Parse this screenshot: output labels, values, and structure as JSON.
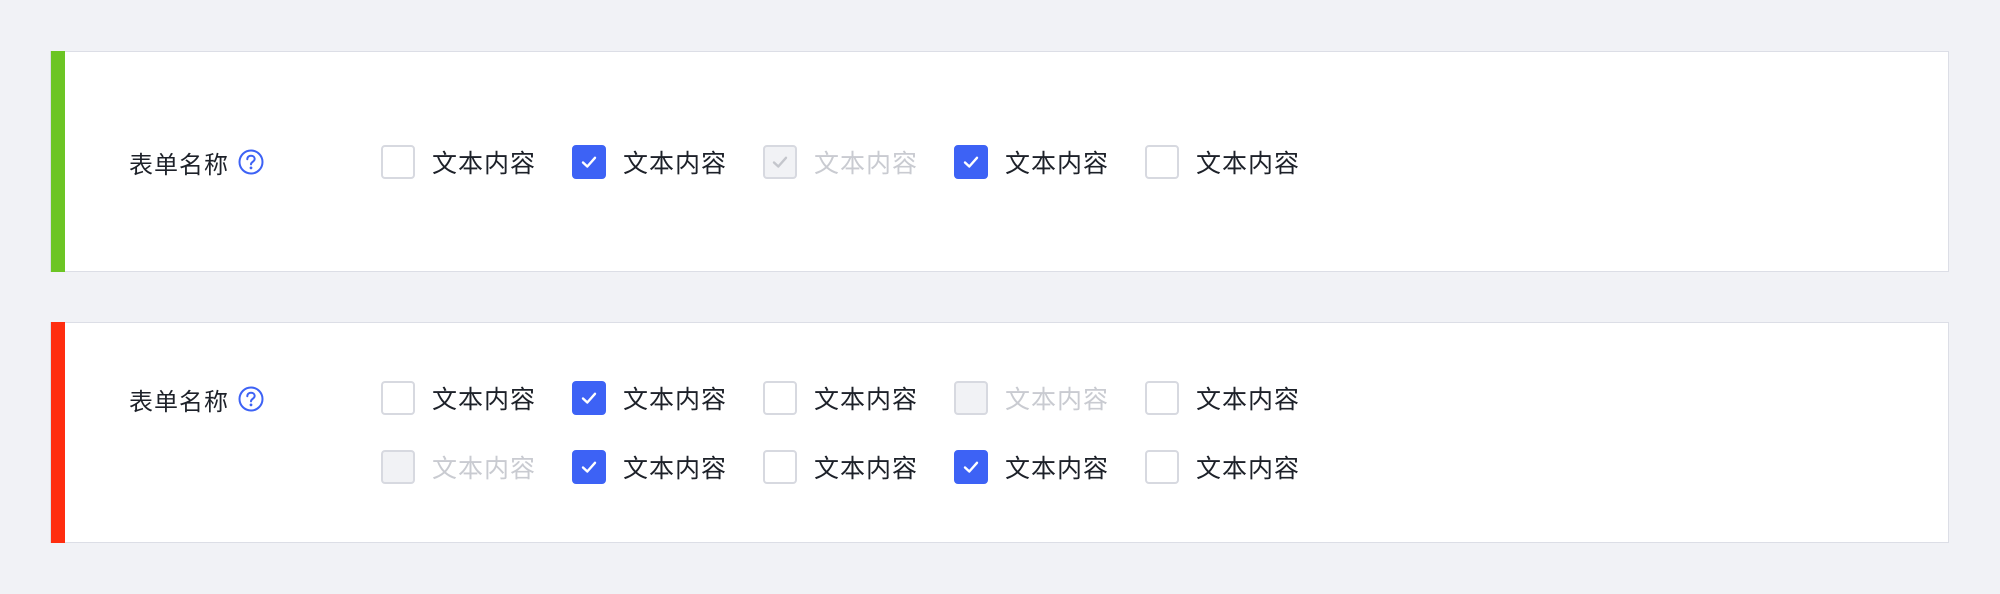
{
  "colors": {
    "page_background": "#f1f2f6",
    "panel_background": "#ffffff",
    "accent_success": "#6cc524",
    "accent_error": "#ff2d0f",
    "checkbox_checked": "#3d62f5",
    "help_icon": "#3d62f5",
    "text_primary": "#1d2129",
    "text_disabled": "#c9cbd1"
  },
  "groups": [
    {
      "label": "表单名称",
      "accent": "success",
      "help_icon": "question-circle-icon",
      "rows": [
        [
          {
            "label": "文本内容",
            "checked": false,
            "disabled": false
          },
          {
            "label": "文本内容",
            "checked": true,
            "disabled": false
          },
          {
            "label": "文本内容",
            "checked": true,
            "disabled": true
          },
          {
            "label": "文本内容",
            "checked": true,
            "disabled": false
          },
          {
            "label": "文本内容",
            "checked": false,
            "disabled": false
          }
        ]
      ]
    },
    {
      "label": "表单名称",
      "accent": "error",
      "help_icon": "question-circle-icon",
      "rows": [
        [
          {
            "label": "文本内容",
            "checked": false,
            "disabled": false
          },
          {
            "label": "文本内容",
            "checked": true,
            "disabled": false
          },
          {
            "label": "文本内容",
            "checked": false,
            "disabled": false
          },
          {
            "label": "文本内容",
            "checked": false,
            "disabled": true
          },
          {
            "label": "文本内容",
            "checked": false,
            "disabled": false
          }
        ],
        [
          {
            "label": "文本内容",
            "checked": false,
            "disabled": true
          },
          {
            "label": "文本内容",
            "checked": true,
            "disabled": false
          },
          {
            "label": "文本内容",
            "checked": false,
            "disabled": false
          },
          {
            "label": "文本内容",
            "checked": true,
            "disabled": false
          },
          {
            "label": "文本内容",
            "checked": false,
            "disabled": false
          }
        ]
      ]
    }
  ]
}
